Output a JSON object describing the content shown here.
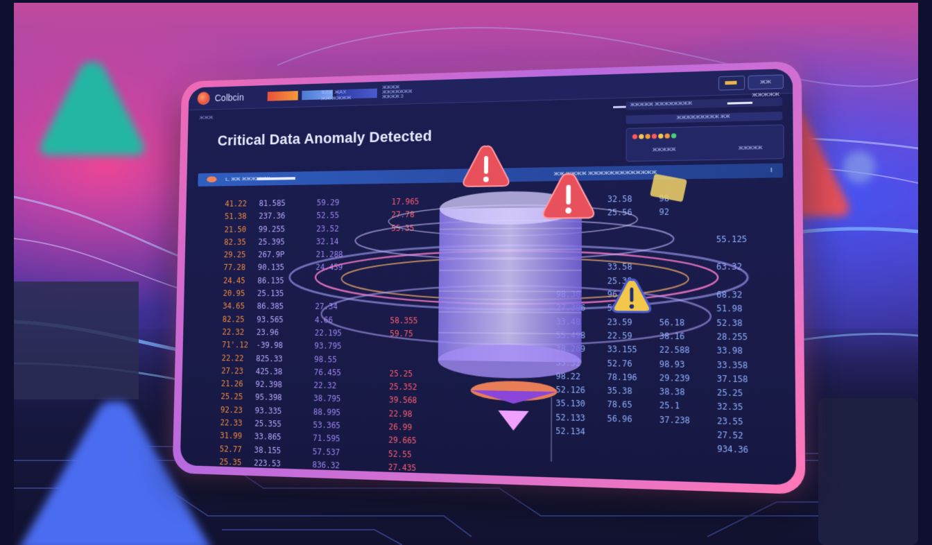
{
  "app": {
    "name": "Colbcin",
    "header_micro_1": "ФЛЖ ЖАХ\nЖЖ ЖЖЖЖ",
    "header_micro_2": "ЖЖЖЖ\nЖЖЖЖЖЖЖ\nЖЖЖЖ З",
    "action_label": "ЖЖ ЖЖЖЖЖ",
    "breadcrumb": "ЖЖЖ"
  },
  "title": "Critical Data Anomaly Detected",
  "right_panel": {
    "row1": "ЖЖЖЖЖ ЖЖЖЖЖЖЖЖ",
    "row2": "ЖЖЖЖЖЖЖЖЖ ЖЖ",
    "button_left": "ЖЖЖЖЖ",
    "button_right": "ЖЖЖЖЖ",
    "status_dot_colors": [
      "#ff5a5a",
      "#f5c84a",
      "#f59a3a",
      "#ff5a5a",
      "#f5c84a",
      "#f59a3a",
      "#4ad07a"
    ]
  },
  "filter_bar": {
    "label": "L, ЖЖ ЖЖЖЖЖЖ",
    "right_label": "ЖЖ ЖЖЖЖ ЖЖЖЖЖЖЖЖЖЖЖЖЖ",
    "end_label": "I"
  },
  "table": {
    "col1": [
      "41.22",
      "51.38",
      "21.50",
      "82.35",
      "29.25",
      "77.28",
      "24.45",
      "20.95",
      "34.65",
      "82.25",
      "22.32",
      "71'.12",
      "22.22",
      "27.23",
      "21.26",
      "25.25",
      "92.23",
      "22.33",
      "31.99",
      "52.77",
      "25.35"
    ],
    "col2": [
      "81.585",
      "237.36",
      "99.255",
      "25.395",
      "267.9P",
      "90.135",
      "86.135",
      "25.135",
      "86.385",
      "93.565",
      "23.96",
      "-39.98",
      "825.33",
      "425.38",
      "92.398",
      "95.398",
      "93.335",
      "25.355",
      "33.865",
      "38.155",
      "223.53"
    ],
    "col3": [
      "59.29",
      "52.55",
      "23.52",
      "32.14",
      "21.288",
      "24.459",
      "",
      "",
      "27.34",
      "4.66",
      "22.195",
      "93.795",
      "98.55",
      "76.455",
      "22.32",
      "38.795",
      "88.995",
      "53.365",
      "71.595",
      "57.537",
      "836.32"
    ],
    "col4": [
      "17.965",
      "27.78",
      "55.35",
      "",
      "",
      "",
      "",
      "",
      "",
      "58.355",
      "59.75",
      "",
      "",
      "25.25",
      "25.352",
      "39.568",
      "22.98",
      "26.99",
      "29.665",
      "52.55",
      "27.435"
    ],
    "col5": [
      "88",
      "",
      "",
      "",
      "",
      "",
      "",
      "98.30",
      "27.396",
      "33.48",
      "55.498",
      "38.269",
      "33.32",
      "98.22",
      "52.126",
      "35.130",
      "52.133",
      "52.134"
    ],
    "col6": [
      "32.58",
      "25.56",
      "",
      "",
      "",
      "33.58",
      "25.38",
      "96.136",
      "52.96",
      "23.59",
      "22.59",
      "33.155",
      "52.76",
      "78.196",
      "35.38",
      "78.65",
      "56.96"
    ],
    "col7": [
      "98",
      "92",
      "",
      "",
      "",
      "",
      "",
      "",
      "",
      "56.18",
      "38.16",
      "22.588",
      "98.93",
      "29.239",
      "38.38",
      "25.1",
      "37.238"
    ],
    "col8": [
      "",
      "",
      "",
      "55.125",
      "",
      "63.32",
      "",
      "68.32",
      "51.98",
      "52.38",
      "28.255",
      "33.98",
      "33.358",
      "37.158",
      "25.25",
      "32.35",
      "23.55",
      "27.52",
      "934.36"
    ]
  },
  "colors": {
    "accent_pink": "#f06ab5",
    "warning_red": "#e8505b",
    "warning_yellow": "#f3c84a",
    "screen_bg": "#1b1d52"
  }
}
